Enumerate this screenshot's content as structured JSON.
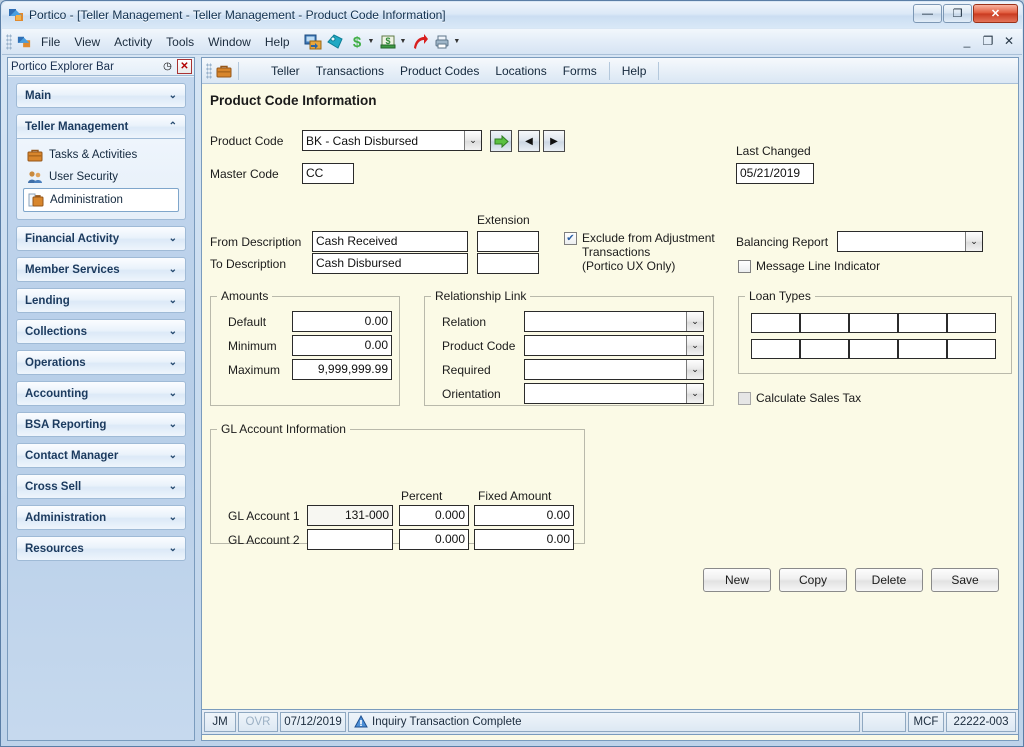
{
  "window": {
    "title": "Portico - [Teller Management - Teller Management - Product Code Information]",
    "icon": "portico-app-icon",
    "minimize_label": "—",
    "maximize_label": "❐",
    "close_label": "✕"
  },
  "menubar": {
    "items": [
      {
        "label": "File"
      },
      {
        "label": "View"
      },
      {
        "label": "Activity"
      },
      {
        "label": "Tools"
      },
      {
        "label": "Window"
      },
      {
        "label": "Help"
      }
    ],
    "toolbar_icons": [
      {
        "name": "transfer-icon"
      },
      {
        "name": "tag-icon"
      },
      {
        "name": "dollar-icon"
      },
      {
        "name": "cash-drawer-icon"
      },
      {
        "name": "red-arrow-icon"
      },
      {
        "name": "printer-icon"
      }
    ],
    "mdi": {
      "minimize_label": "_",
      "restore_label": "❐",
      "close_label": "✕"
    }
  },
  "explorer": {
    "title": "Portico Explorer Bar",
    "auto_hide_label": "◷",
    "close_label": "✕",
    "groups": [
      {
        "label": "Main",
        "expanded": false,
        "chevron": "⌄",
        "items": []
      },
      {
        "label": "Teller Management",
        "expanded": true,
        "chevron": "⌃",
        "items": [
          {
            "label": "Tasks & Activities",
            "icon": "briefcase-icon",
            "selected": false
          },
          {
            "label": "User Security",
            "icon": "users-icon",
            "selected": false
          },
          {
            "label": "Administration",
            "icon": "administration-icon",
            "selected": true
          }
        ]
      },
      {
        "label": "Financial Activity",
        "expanded": false,
        "chevron": "⌄",
        "items": []
      },
      {
        "label": "Member Services",
        "expanded": false,
        "chevron": "⌄",
        "items": []
      },
      {
        "label": "Lending",
        "expanded": false,
        "chevron": "⌄",
        "items": []
      },
      {
        "label": "Collections",
        "expanded": false,
        "chevron": "⌄",
        "items": []
      },
      {
        "label": "Operations",
        "expanded": false,
        "chevron": "⌄",
        "items": []
      },
      {
        "label": "Accounting",
        "expanded": false,
        "chevron": "⌄",
        "items": []
      },
      {
        "label": "BSA Reporting",
        "expanded": false,
        "chevron": "⌄",
        "items": []
      },
      {
        "label": "Contact Manager",
        "expanded": false,
        "chevron": "⌄",
        "items": []
      },
      {
        "label": "Cross Sell",
        "expanded": false,
        "chevron": "⌄",
        "items": []
      },
      {
        "label": "Administration",
        "expanded": false,
        "chevron": "⌄",
        "items": []
      },
      {
        "label": "Resources",
        "expanded": false,
        "chevron": "⌄",
        "items": []
      }
    ]
  },
  "app_toolbar": {
    "icon": "briefcase-icon",
    "menus": [
      {
        "label": "Teller"
      },
      {
        "label": "Transactions"
      },
      {
        "label": "Product Codes"
      },
      {
        "label": "Locations"
      },
      {
        "label": "Forms"
      },
      {
        "label": "Help"
      }
    ]
  },
  "form": {
    "title": "Product Code Information",
    "product_code": {
      "label": "Product Code",
      "value": "BK - Cash Disbursed",
      "arrow": "⌄"
    },
    "nav": {
      "go_label": "➡",
      "prev_label": "◀",
      "next_label": "▶"
    },
    "master_code": {
      "label": "Master Code",
      "value": "CC"
    },
    "last_changed": {
      "label": "Last Changed",
      "value": "05/21/2019"
    },
    "extension_header": "Extension",
    "from_description": {
      "label": "From Description",
      "value": "Cash Received",
      "extension": ""
    },
    "to_description": {
      "label": "To Description",
      "value": "Cash Disbursed",
      "extension": ""
    },
    "exclude_adjustment": {
      "line1": "Exclude from Adjustment",
      "line2": "Transactions",
      "line3": "(Portico UX Only)",
      "checked": true
    },
    "balancing_report": {
      "label": "Balancing Report",
      "value": "",
      "arrow": "⌄"
    },
    "message_line_indicator": {
      "label": "Message Line Indicator",
      "checked": false
    },
    "amounts": {
      "legend": "Amounts",
      "rows": [
        {
          "label": "Default",
          "value": "0.00"
        },
        {
          "label": "Minimum",
          "value": "0.00"
        },
        {
          "label": "Maximum",
          "value": "9,999,999.99"
        }
      ]
    },
    "relationship_link": {
      "legend": "Relationship Link",
      "rows": [
        {
          "label": "Relation",
          "value": "",
          "arrow": "⌄"
        },
        {
          "label": "Product Code",
          "value": "",
          "arrow": "⌄"
        },
        {
          "label": "Required",
          "value": "",
          "arrow": "⌄"
        },
        {
          "label": "Orientation",
          "value": "",
          "arrow": "⌄"
        }
      ]
    },
    "loan_types": {
      "legend": "Loan Types",
      "values": [
        "",
        "",
        "",
        "",
        "",
        "",
        "",
        "",
        "",
        ""
      ]
    },
    "calculate_sales_tax": {
      "label": "Calculate Sales Tax",
      "checked": false
    },
    "gl_account": {
      "legend": "GL Account Information",
      "col_percent": "Percent",
      "col_fixed": "Fixed Amount",
      "rows": [
        {
          "label": "GL Account 1",
          "account": "131-000",
          "percent": "0.000",
          "fixed": "0.00"
        },
        {
          "label": "GL Account 2",
          "account": "",
          "percent": "0.000",
          "fixed": "0.00"
        }
      ]
    },
    "buttons": [
      {
        "label": "New",
        "name": "new-button"
      },
      {
        "label": "Copy",
        "name": "copy-button"
      },
      {
        "label": "Delete",
        "name": "delete-button"
      },
      {
        "label": "Save",
        "name": "save-button"
      }
    ]
  },
  "status_bar": {
    "user": "JM",
    "overwrite": "OVR",
    "date": "07/12/2019",
    "message": "Inquiry Transaction Complete",
    "message_icon": "warning-icon",
    "blank": "",
    "institution": "MCF",
    "terminal": "22222-003"
  },
  "colors": {
    "form_background": "#fbfae6",
    "accent_blue": "#2a5fa5",
    "close_red": "#c93a20",
    "go_green": "#4aa832"
  }
}
